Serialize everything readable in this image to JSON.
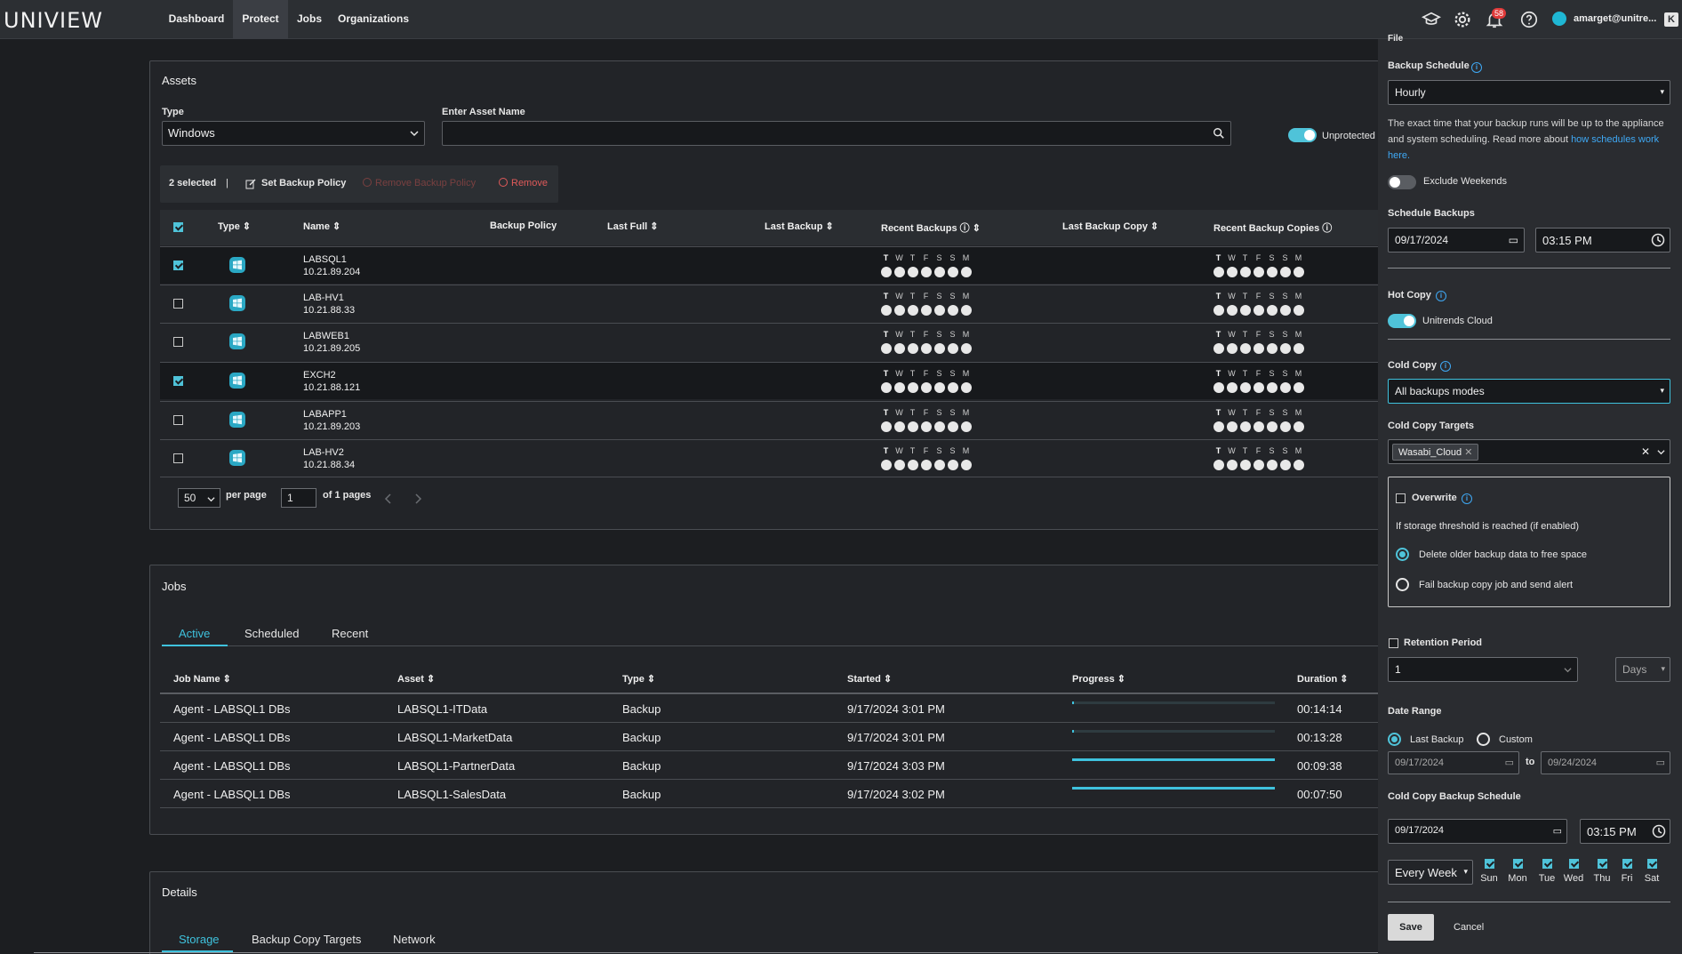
{
  "app": {
    "logo": "UNIVIEW"
  },
  "nav": {
    "items": [
      "Dashboard",
      "Protect",
      "Jobs",
      "Organizations"
    ],
    "active": "Protect"
  },
  "header": {
    "notifications": "58",
    "user": "amarget@unitre..."
  },
  "assets": {
    "title": "Assets",
    "type_label": "Type",
    "type_value": "Windows",
    "name_label": "Enter Asset Name",
    "name_value": "",
    "unprotected_label": "Unprotected",
    "toolbar": {
      "selected": "2 selected",
      "sep": "|",
      "set_policy": "Set Backup Policy",
      "remove_policy": "Remove Backup Policy",
      "remove": "Remove"
    },
    "columns": [
      "Type",
      "Name",
      "Backup Policy",
      "Last Full",
      "Last Backup",
      "Recent Backups",
      "Last Backup Copy",
      "Recent Backup Copies"
    ],
    "day_letters": [
      "T",
      "W",
      "T",
      "F",
      "S",
      "S",
      "M"
    ],
    "rows": [
      {
        "name": "LABSQL1",
        "ip": "10.21.89.204",
        "checked": true
      },
      {
        "name": "LAB-HV1",
        "ip": "10.21.88.33",
        "checked": false
      },
      {
        "name": "LABWEB1",
        "ip": "10.21.89.205",
        "checked": false
      },
      {
        "name": "EXCH2",
        "ip": "10.21.88.121",
        "checked": true
      },
      {
        "name": "LABAPP1",
        "ip": "10.21.89.203",
        "checked": false
      },
      {
        "name": "LAB-HV2",
        "ip": "10.21.88.34",
        "checked": false
      }
    ],
    "pager": {
      "per_page_value": "50",
      "per_page_label": "per page",
      "page_value": "1",
      "of_pages": "of 1 pages"
    }
  },
  "jobs": {
    "title": "Jobs",
    "tabs": [
      "Active",
      "Scheduled",
      "Recent"
    ],
    "columns": [
      "Job Name",
      "Asset",
      "Type",
      "Started",
      "Progress",
      "Duration"
    ],
    "rows": [
      {
        "job": "Agent - LABSQL1 DBs",
        "asset": "LABSQL1-ITData",
        "type": "Backup",
        "started": "9/17/2024 3:01 PM",
        "progress": 0.01,
        "duration": "00:14:14"
      },
      {
        "job": "Agent - LABSQL1 DBs",
        "asset": "LABSQL1-MarketData",
        "type": "Backup",
        "started": "9/17/2024 3:01 PM",
        "progress": 0.01,
        "duration": "00:13:28"
      },
      {
        "job": "Agent - LABSQL1 DBs",
        "asset": "LABSQL1-PartnerData",
        "type": "Backup",
        "started": "9/17/2024 3:03 PM",
        "progress": 1.0,
        "duration": "00:09:38"
      },
      {
        "job": "Agent - LABSQL1 DBs",
        "asset": "LABSQL1-SalesData",
        "type": "Backup",
        "started": "9/17/2024 3:02 PM",
        "progress": 1.0,
        "duration": "00:07:50"
      }
    ]
  },
  "details": {
    "title": "Details",
    "tabs": [
      "Storage",
      "Backup Copy Targets",
      "Network"
    ]
  },
  "policy": {
    "file_label": "File",
    "backup_schedule_label": "Backup Schedule",
    "backup_schedule_value": "Hourly",
    "schedule_note": "The exact time that your backup runs will be up to the appliance and system scheduling. Read more about ",
    "schedule_link": "how schedules work here.",
    "exclude_weekends": "Exclude Weekends",
    "schedule_backups_label": "Schedule Backups",
    "schedule_date": "09/17/2024",
    "schedule_time": "03:15 PM",
    "hot_copy_label": "Hot Copy",
    "hot_copy_target": "Unitrends Cloud",
    "cold_copy_label": "Cold Copy",
    "cold_copy_value": "All backups modes",
    "cold_copy_targets_label": "Cold Copy Targets",
    "cold_copy_target_chip": "Wasabi_Cloud",
    "overwrite_label": "Overwrite",
    "threshold_text": "If storage threshold is reached (if enabled)",
    "option_delete": "Delete older backup data to free space",
    "option_fail": "Fail backup copy job and send alert",
    "retention_label": "Retention Period",
    "retention_value": "1",
    "retention_unit": "Days",
    "date_range_label": "Date Range",
    "range_last": "Last Backup",
    "range_custom": "Custom",
    "range_from": "09/17/2024",
    "range_to_label": "to",
    "range_to": "09/24/2024",
    "ccbs_label": "Cold Copy Backup Schedule",
    "ccbs_date": "09/17/2024",
    "ccbs_time": "03:15 PM",
    "frequency": "Every Week",
    "weekdays": [
      "Sun",
      "Mon",
      "Tue",
      "Wed",
      "Thu",
      "Fri",
      "Sat"
    ],
    "save": "Save",
    "cancel": "Cancel"
  },
  "colors": {
    "accent": "#3fc2dd",
    "link": "#3fa9f5",
    "danger": "#e05a5a",
    "panel": "#222428",
    "page": "#1c1e21"
  }
}
